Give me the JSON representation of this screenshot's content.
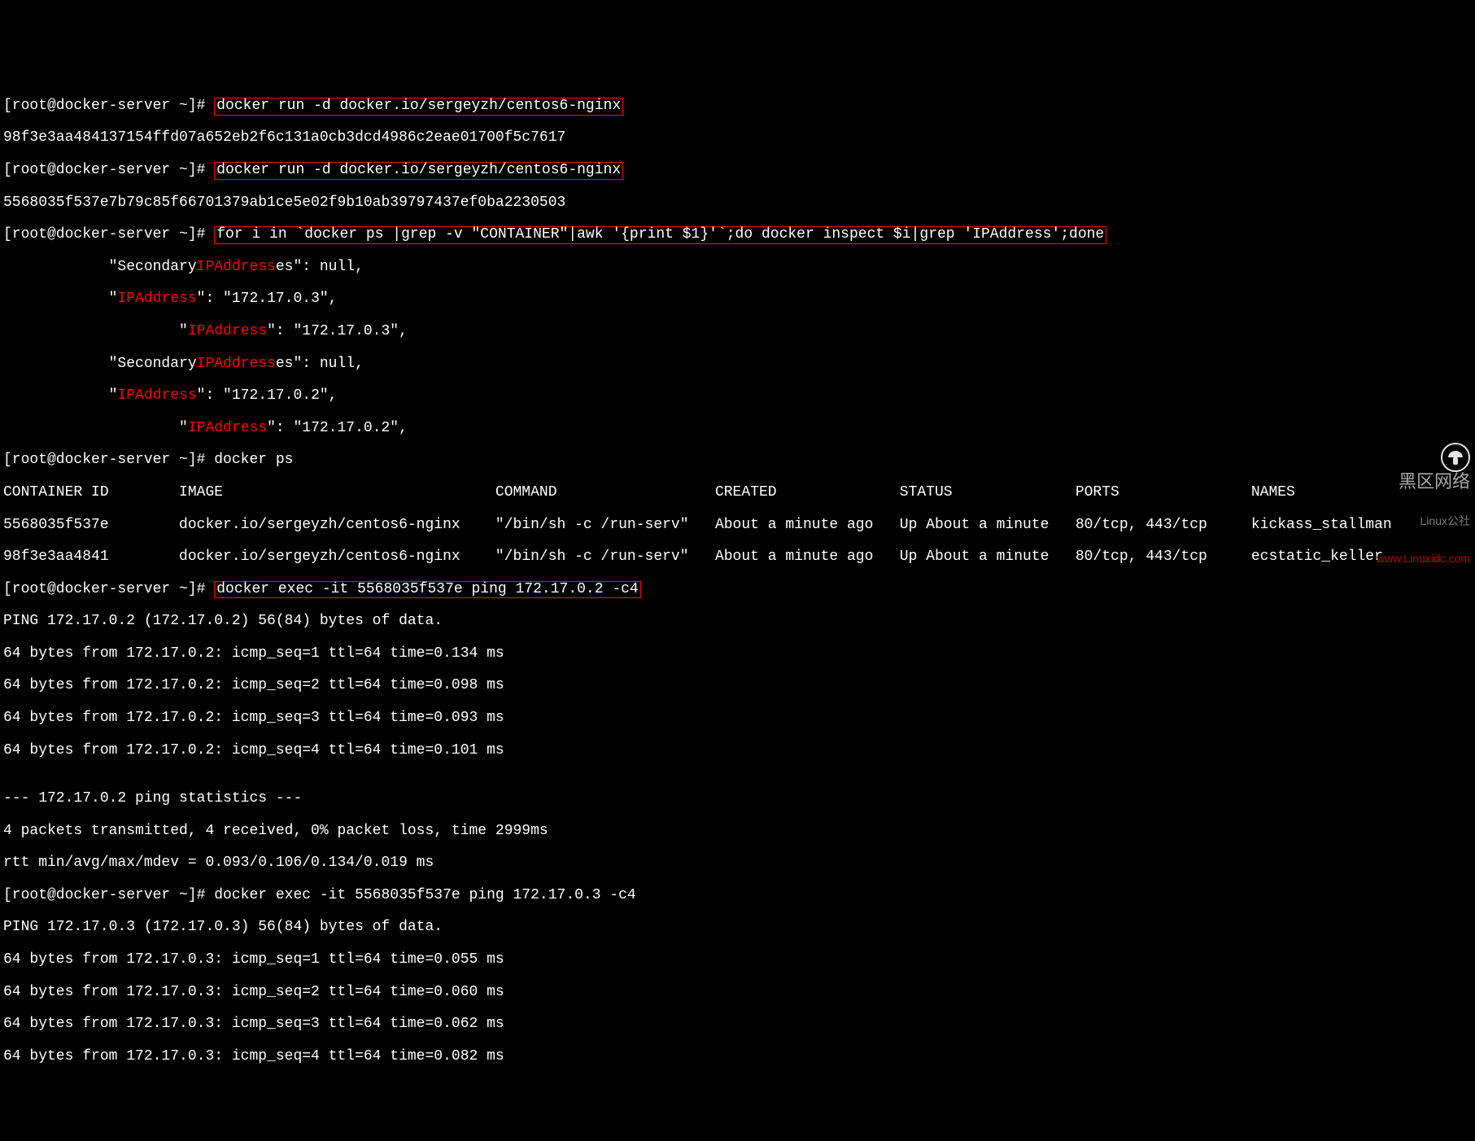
{
  "prompt": "[root@docker-server ~]# ",
  "cmd1": "docker run -d docker.io/sergeyzh/centos6-nginx",
  "hash1": "98f3e3aa484137154ffd07a652eb2f6c131a0cb3dcd4986c2eae01700f5c7617",
  "cmd2": "docker run -d docker.io/sergeyzh/centos6-nginx",
  "hash2": "5568035f537e7b79c85f66701379ab1ce5e02f9b10ab39797437ef0ba2230503",
  "cmd3": "for i in `docker ps |grep -v \"CONTAINER\"|awk '{print $1}'`;do docker inspect $i|grep 'IPAddress';done",
  "ip_out": {
    "a1_pre": "            \"Secondary",
    "a1_mid": "IPAddress",
    "a1_suf": "es\": null,",
    "a2_pre": "            \"",
    "a2_mid": "IPAddress",
    "a2_suf": "\": \"172.17.0.3\",",
    "a3_pre": "                    \"",
    "a3_mid": "IPAddress",
    "a3_suf": "\": \"172.17.0.3\",",
    "b1_pre": "            \"Secondary",
    "b1_mid": "IPAddress",
    "b1_suf": "es\": null,",
    "b2_pre": "            \"",
    "b2_mid": "IPAddress",
    "b2_suf": "\": \"172.17.0.2\",",
    "b3_pre": "                    \"",
    "b3_mid": "IPAddress",
    "b3_suf": "\": \"172.17.0.2\","
  },
  "cmd4": "docker ps",
  "ps_header": "CONTAINER ID        IMAGE                               COMMAND                  CREATED              STATUS              PORTS               NAMES",
  "ps_rows": [
    "5568035f537e        docker.io/sergeyzh/centos6-nginx    \"/bin/sh -c /run-serv\"   About a minute ago   Up About a minute   80/tcp, 443/tcp     kickass_stallman",
    "98f3e3aa4841        docker.io/sergeyzh/centos6-nginx    \"/bin/sh -c /run-serv\"   About a minute ago   Up About a minute   80/tcp, 443/tcp     ecstatic_keller"
  ],
  "cmd5": "docker exec -it 5568035f537e ping 172.17.0.2 -c4",
  "ping1": [
    "PING 172.17.0.2 (172.17.0.2) 56(84) bytes of data.",
    "64 bytes from 172.17.0.2: icmp_seq=1 ttl=64 time=0.134 ms",
    "64 bytes from 172.17.0.2: icmp_seq=2 ttl=64 time=0.098 ms",
    "64 bytes from 172.17.0.2: icmp_seq=3 ttl=64 time=0.093 ms",
    "64 bytes from 172.17.0.2: icmp_seq=4 ttl=64 time=0.101 ms",
    "",
    "--- 172.17.0.2 ping statistics ---",
    "4 packets transmitted, 4 received, 0% packet loss, time 2999ms",
    "rtt min/avg/max/mdev = 0.093/0.106/0.134/0.019 ms"
  ],
  "cmd6": "docker exec -it 5568035f537e ping 172.17.0.3 -c4",
  "ping2": [
    "PING 172.17.0.3 (172.17.0.3) 56(84) bytes of data.",
    "64 bytes from 172.17.0.3: icmp_seq=1 ttl=64 time=0.055 ms",
    "64 bytes from 172.17.0.3: icmp_seq=2 ttl=64 time=0.060 ms",
    "64 bytes from 172.17.0.3: icmp_seq=3 ttl=64 time=0.062 ms",
    "64 bytes from 172.17.0.3: icmp_seq=4 ttl=64 time=0.082 ms"
  ],
  "watermark": {
    "title": "黑区网络",
    "sub": "Linux公社",
    "url": "www.Linuxidc.com"
  }
}
